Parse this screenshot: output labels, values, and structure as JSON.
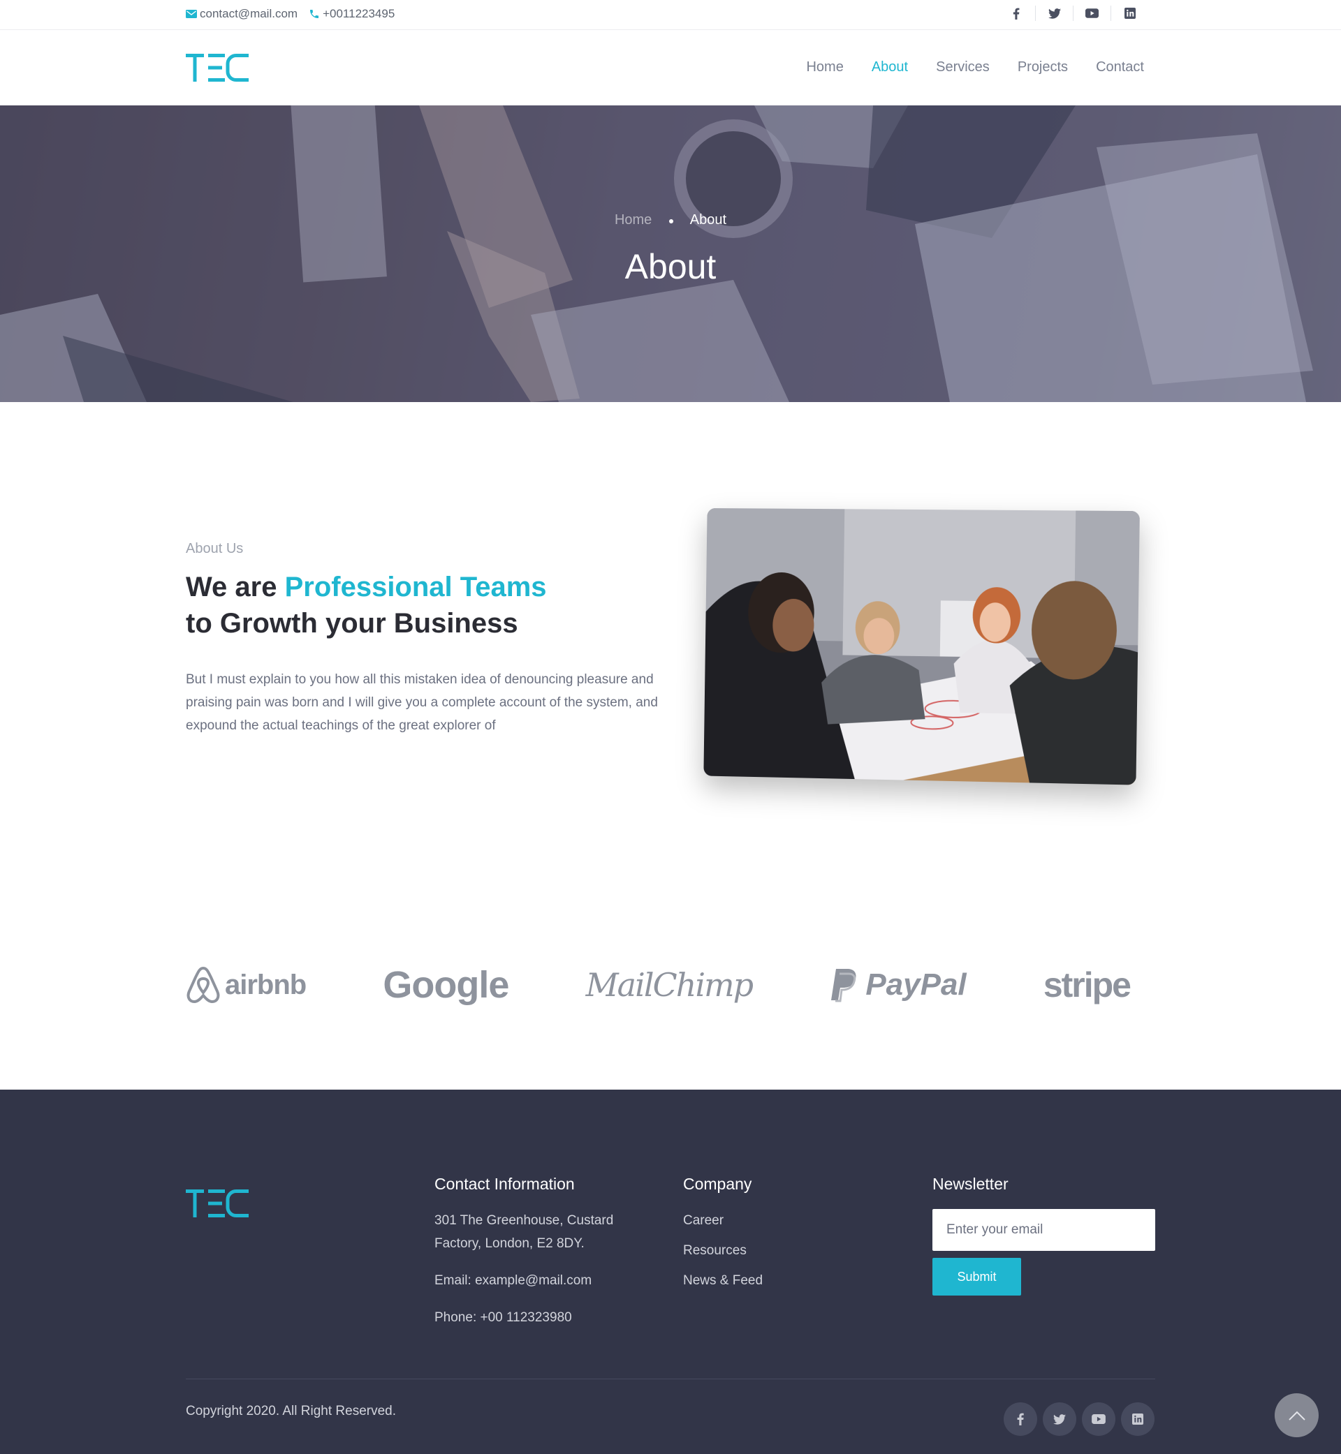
{
  "topbar": {
    "email": "contact@mail.com",
    "phone": "+0011223495",
    "social": [
      "facebook-icon",
      "twitter-icon",
      "youtube-icon",
      "linkedin-icon"
    ]
  },
  "brand": {
    "logo_text": "TEC",
    "accent_color": "#1fb6d0"
  },
  "nav": {
    "items": [
      {
        "label": "Home"
      },
      {
        "label": "About"
      },
      {
        "label": "Services"
      },
      {
        "label": "Projects"
      },
      {
        "label": "Contact"
      }
    ],
    "active": "About"
  },
  "hero": {
    "breadcrumb_home": "Home",
    "breadcrumb_current": "About",
    "title": "About"
  },
  "about": {
    "label": "About Us",
    "heading_pre": "We are",
    "heading_accent": "Professional Teams",
    "heading_line2": "to Growth your Business",
    "text": "But I must explain to you how all this mistaken idea of denouncing pleasure and praising pain was born and I will give you a complete account of the system, and expound the actual teachings of the great explorer of"
  },
  "brands": [
    "airbnb",
    "Google",
    "MailChimp",
    "PayPal",
    "stripe"
  ],
  "footer": {
    "contact": {
      "heading": "Contact Information",
      "address": "301 The Greenhouse, Custard Factory, London, E2 8DY.",
      "email": "Email: example@mail.com",
      "phone": "Phone: +00 112323980"
    },
    "company": {
      "heading": "Company",
      "links": [
        "Career",
        "Resources",
        "News & Feed"
      ]
    },
    "newsletter": {
      "heading": "Newsletter",
      "placeholder": "Enter your email",
      "button": "Submit"
    },
    "copyright": "Copyright 2020. All Right Reserved."
  }
}
